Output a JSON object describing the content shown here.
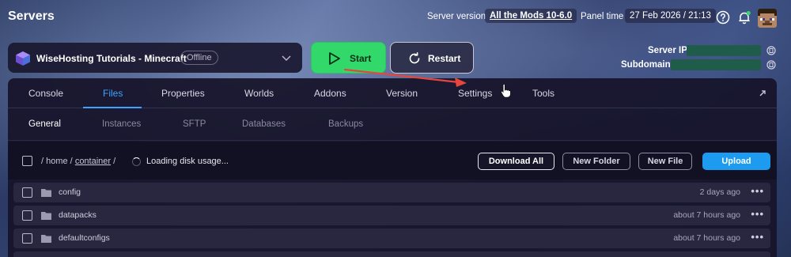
{
  "header": {
    "title": "Servers",
    "server_version_label": "Server version",
    "server_version_value": "All the Mods 10-6.0",
    "panel_time_label": "Panel time",
    "panel_time_value": "27 Feb 2026 / 21:13",
    "icons": [
      "help-icon",
      "bell-icon",
      "avatar"
    ]
  },
  "server": {
    "name": "WiseHosting Tutorials - Minecraft",
    "status": "Offline",
    "start_label": "Start",
    "restart_label": "Restart",
    "ip_label": "Server IP",
    "subdomain_label": "Subdomain"
  },
  "tabs": [
    {
      "label": "Console"
    },
    {
      "label": "Files"
    },
    {
      "label": "Properties"
    },
    {
      "label": "Worlds"
    },
    {
      "label": "Addons"
    },
    {
      "label": "Version"
    },
    {
      "label": "Settings"
    },
    {
      "label": "Tools"
    }
  ],
  "active_tab": "Files",
  "subtabs": [
    {
      "label": "General"
    },
    {
      "label": "Instances"
    },
    {
      "label": "SFTP"
    },
    {
      "label": "Databases"
    },
    {
      "label": "Backups"
    }
  ],
  "active_subtab": "General",
  "files_toolbar": {
    "path_root": "/ home /",
    "path_link": "container",
    "path_sep": "/",
    "loading_text": "Loading disk usage...",
    "download_all": "Download All",
    "new_folder": "New Folder",
    "new_file": "New File",
    "upload": "Upload"
  },
  "files": [
    {
      "name": "config",
      "modified": "2 days ago"
    },
    {
      "name": "datapacks",
      "modified": "about 7 hours ago"
    },
    {
      "name": "defaultconfigs",
      "modified": "about 7 hours ago"
    }
  ],
  "colors": {
    "accent_blue": "#3fa2ff",
    "start_green": "#32d96a",
    "upload_blue": "#1d9bf0",
    "annotation_arrow": "#e8453c"
  }
}
